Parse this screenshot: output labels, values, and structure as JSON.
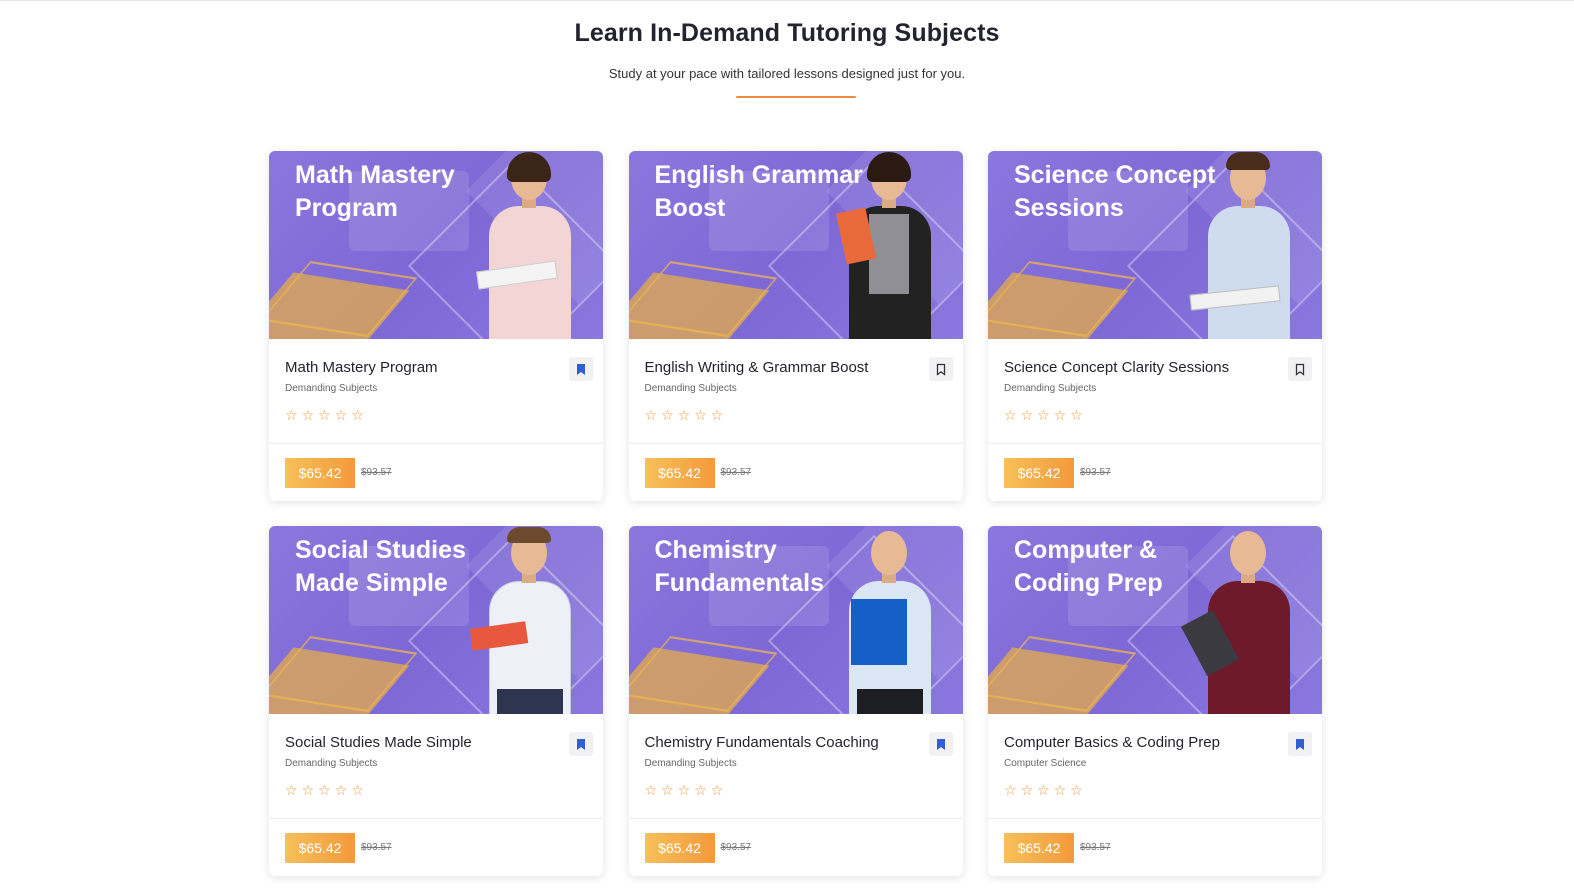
{
  "section": {
    "title": "Learn In-Demand Tutoring Subjects",
    "subtitle": "Study at your pace with tailored lessons designed just for you.",
    "accent_color": "#f08a3c"
  },
  "courses": [
    {
      "banner_title": "Math Mastery Program",
      "name": "Math Mastery Program",
      "category": "Demanding Subjects",
      "rating": 0,
      "stars": [
        "☆",
        "☆",
        "☆",
        "☆",
        "☆"
      ],
      "price": "$65.42",
      "old_price": "$93.57",
      "bookmarked": true
    },
    {
      "banner_title": "English Grammar Boost",
      "name": "English Writing & Grammar Boost",
      "category": "Demanding Subjects",
      "rating": 0,
      "stars": [
        "☆",
        "☆",
        "☆",
        "☆",
        "☆"
      ],
      "price": "$65.42",
      "old_price": "$93.57",
      "bookmarked": false
    },
    {
      "banner_title": "Science Concept Sessions",
      "name": "Science Concept Clarity Sessions",
      "category": "Demanding Subjects",
      "rating": 0,
      "stars": [
        "☆",
        "☆",
        "☆",
        "☆",
        "☆"
      ],
      "price": "$65.42",
      "old_price": "$93.57",
      "bookmarked": false
    },
    {
      "banner_title": "Social Studies Made Simple",
      "name": "Social Studies Made Simple",
      "category": "Demanding Subjects",
      "rating": 0,
      "stars": [
        "☆",
        "☆",
        "☆",
        "☆",
        "☆"
      ],
      "price": "$65.42",
      "old_price": "$93.57",
      "bookmarked": true
    },
    {
      "banner_title": "Chemistry Fundamentals",
      "name": "Chemistry Fundamentals Coaching",
      "category": "Demanding Subjects",
      "rating": 0,
      "stars": [
        "☆",
        "☆",
        "☆",
        "☆",
        "☆"
      ],
      "price": "$65.42",
      "old_price": "$93.57",
      "bookmarked": true
    },
    {
      "banner_title": "Computer & Coding Prep",
      "name": "Computer Basics & Coding Prep",
      "category": "Computer Science",
      "rating": 0,
      "stars": [
        "☆",
        "☆",
        "☆",
        "☆",
        "☆"
      ],
      "price": "$65.42",
      "old_price": "$93.57",
      "bookmarked": true
    }
  ],
  "colors": {
    "banner_purple": "#7d68d6",
    "price_gradient_start": "#f7c05a",
    "price_gradient_end": "#f39a3c",
    "bookmark_active": "#2f5fd0",
    "star": "#f29a3a"
  },
  "icons": {
    "bookmark": "bookmark-icon",
    "star": "star-outline-icon"
  }
}
